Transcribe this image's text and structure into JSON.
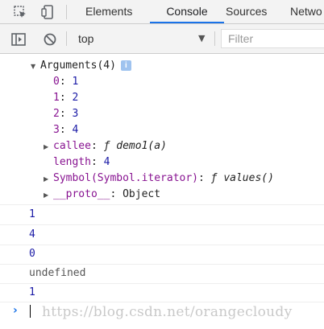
{
  "tabs": {
    "elements": "Elements",
    "console": "Console",
    "sources": "Sources",
    "network": "Netwo"
  },
  "toolbar": {
    "context": "top",
    "filter_placeholder": "Filter"
  },
  "log": {
    "args_header": "Arguments(4)",
    "info_badge": "i",
    "entries": [
      {
        "key": "0",
        "value": "1"
      },
      {
        "key": "1",
        "value": "2"
      },
      {
        "key": "2",
        "value": "3"
      },
      {
        "key": "3",
        "value": "4"
      }
    ],
    "callee_key": "callee",
    "callee_value": "ƒ demo1(a)",
    "length_key": "length",
    "length_value": "4",
    "symbol_key": "Symbol(Symbol.iterator)",
    "symbol_value": "ƒ values()",
    "proto_key": "__proto__",
    "proto_value": "Object"
  },
  "results": [
    "1",
    "4",
    "0",
    "undefined",
    "1"
  ],
  "watermark": "https://blog.csdn.net/orangecloudy",
  "colors": {
    "accent": "#1a73e8",
    "property_key": "#881391",
    "number": "#1a1aa6"
  }
}
